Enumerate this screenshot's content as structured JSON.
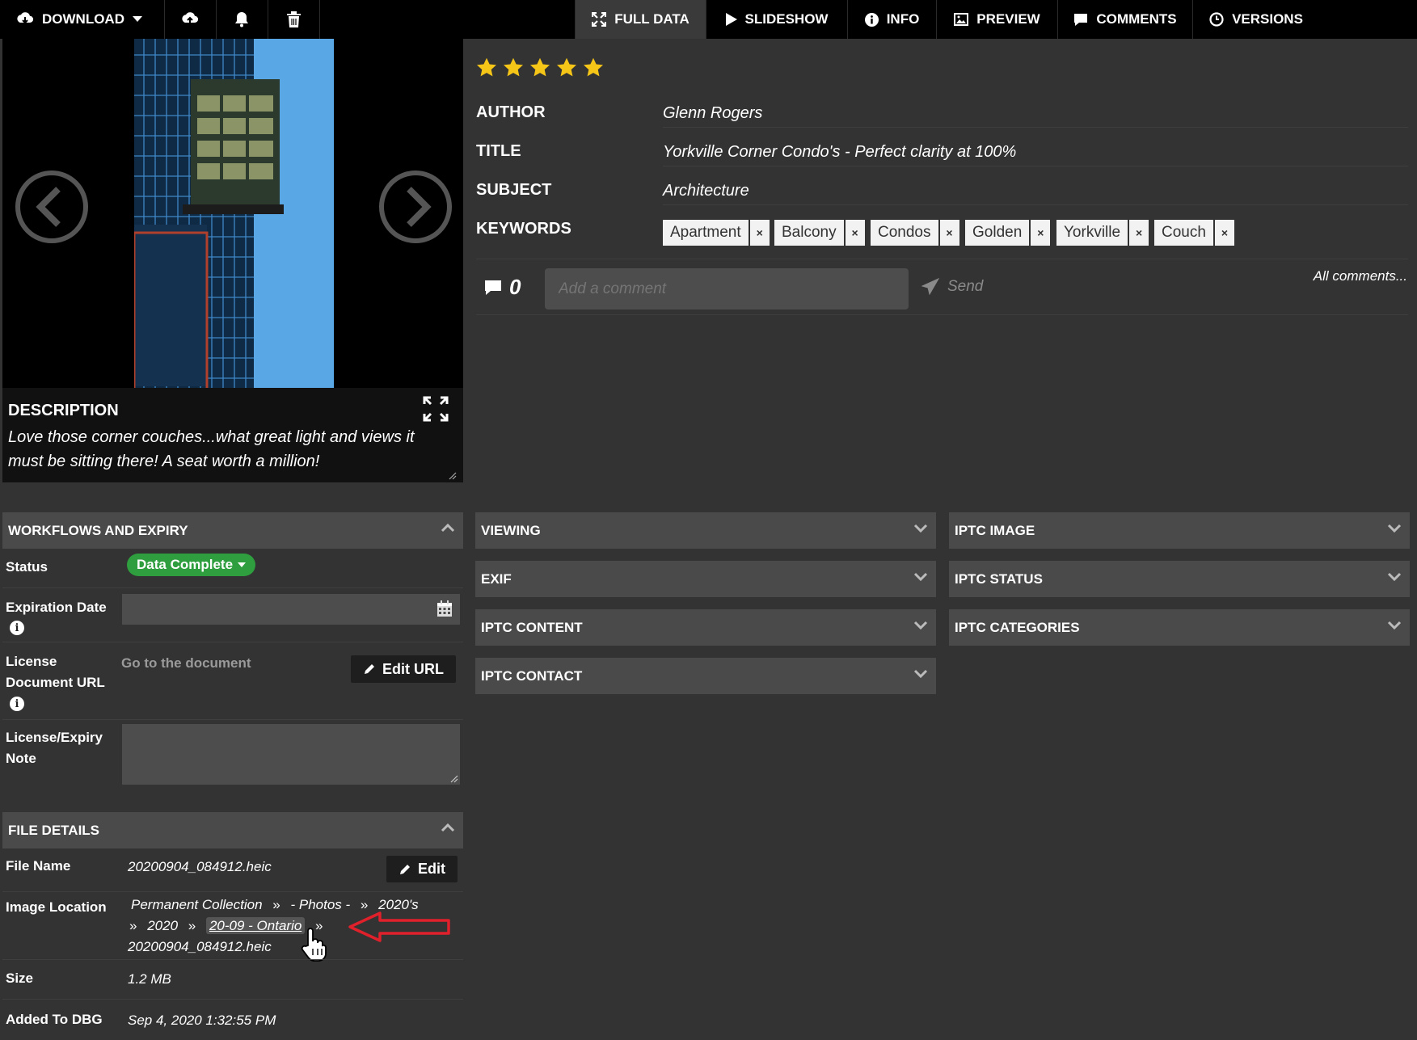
{
  "toolbar": {
    "download_label": "DOWNLOAD",
    "icons": [
      "upload-cloud-icon",
      "bell-icon",
      "trash-icon"
    ]
  },
  "tabs": [
    {
      "label": "FULL DATA",
      "active": true,
      "icon": "expand-icon"
    },
    {
      "label": "SLIDESHOW",
      "active": false,
      "icon": "play-icon"
    },
    {
      "label": "INFO",
      "active": false,
      "icon": "info-icon"
    },
    {
      "label": "PREVIEW",
      "active": false,
      "icon": "image-icon"
    },
    {
      "label": "COMMENTS",
      "active": false,
      "icon": "comment-icon"
    },
    {
      "label": "VERSIONS",
      "active": false,
      "icon": "clock-icon"
    }
  ],
  "description": {
    "heading": "DESCRIPTION",
    "text": "Love those corner couches...what great light and views it must be sitting there!  A seat worth a million!"
  },
  "rating": {
    "stars": 5,
    "max": 5,
    "color": "#f5c518"
  },
  "metadata": {
    "author_label": "AUTHOR",
    "author": "Glenn Rogers",
    "title_label": "TITLE",
    "title": "Yorkville Corner Condo's - Perfect clarity at 100%",
    "subject_label": "SUBJECT",
    "subject": "Architecture",
    "keywords_label": "KEYWORDS",
    "keywords": [
      "Apartment",
      "Balcony",
      "Condos",
      "Golden",
      "Yorkville",
      "Couch"
    ],
    "keyword_remove": "×"
  },
  "comments": {
    "count": "0",
    "placeholder": "Add a comment",
    "send_label": "Send",
    "all_link": "All comments..."
  },
  "workflows": {
    "header": "WORKFLOWS AND EXPIRY",
    "status_label": "Status",
    "status_value": "Data Complete",
    "status_color": "#2e9e3e",
    "expiration_label": "Expiration Date",
    "license_label_1": "License",
    "license_label_2": "Document URL",
    "license_link": "Go to the document",
    "edit_url_label": "Edit URL",
    "note_label_1": "License/Expiry",
    "note_label_2": "Note"
  },
  "file_details": {
    "header": "FILE DETAILS",
    "file_name_label": "File Name",
    "file_name": "20200904_084912.heic",
    "edit_label": "Edit",
    "location_label": "Image Location",
    "location": [
      "Permanent Collection",
      "- Photos -",
      "2020's",
      "2020",
      "20-09 - Ontario",
      "20200904_084912.heic"
    ],
    "size_label": "Size",
    "size": "1.2 MB",
    "added_label": "Added To DBG",
    "added": "Sep 4, 2020 1:32:55 PM"
  },
  "panels_mid": [
    "VIEWING",
    "EXIF",
    "IPTC CONTENT",
    "IPTC CONTACT"
  ],
  "panels_right": [
    "IPTC IMAGE",
    "IPTC STATUS",
    "IPTC CATEGORIES"
  ],
  "colors": {
    "background": "#333333",
    "header_bar": "#4a4a4a",
    "annotation_arrow": "#e0202a"
  }
}
